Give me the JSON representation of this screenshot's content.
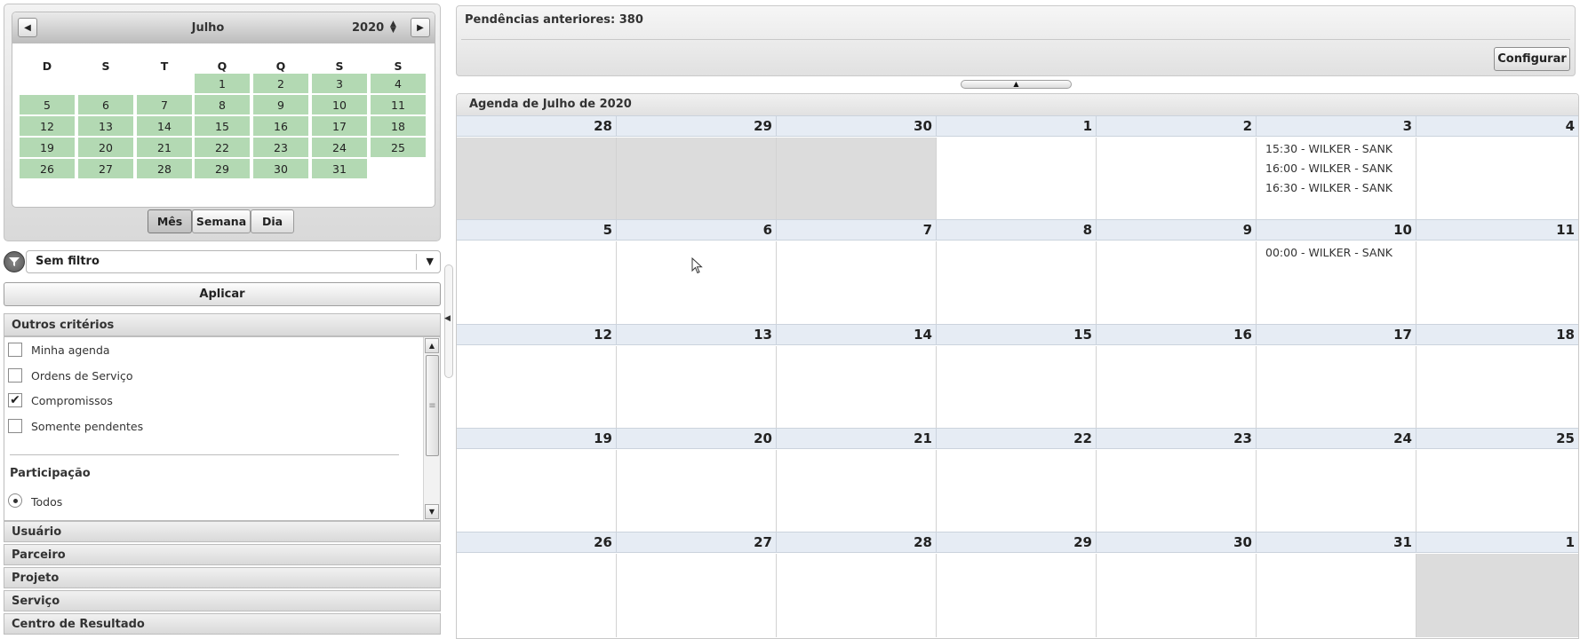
{
  "mini_calendar": {
    "month": "Julho",
    "year": "2020",
    "weekday_headers": [
      "D",
      "S",
      "T",
      "Q",
      "Q",
      "S",
      "S"
    ],
    "weeks": [
      [
        "",
        "",
        "",
        "1",
        "2",
        "3",
        "4"
      ],
      [
        "5",
        "6",
        "7",
        "8",
        "9",
        "10",
        "11"
      ],
      [
        "12",
        "13",
        "14",
        "15",
        "16",
        "17",
        "18"
      ],
      [
        "19",
        "20",
        "21",
        "22",
        "23",
        "24",
        "25"
      ],
      [
        "26",
        "27",
        "28",
        "29",
        "30",
        "31",
        ""
      ]
    ],
    "highlight_color": "#b3d9b3"
  },
  "view_buttons": {
    "month": "Mês",
    "week": "Semana",
    "day": "Dia",
    "active": "month"
  },
  "filter": {
    "selected": "Sem filtro",
    "apply_label": "Aplicar"
  },
  "criteria": {
    "title": "Outros critérios",
    "checkboxes": [
      {
        "label": "Minha agenda",
        "checked": false
      },
      {
        "label": "Ordens de Serviço",
        "checked": false
      },
      {
        "label": "Compromissos",
        "checked": true
      },
      {
        "label": "Somente pendentes",
        "checked": false
      }
    ],
    "participation_title": "Participação",
    "participation_option": "Todos"
  },
  "accordion": [
    "Usuário",
    "Parceiro",
    "Projeto",
    "Serviço",
    "Centro de Resultado"
  ],
  "pending": {
    "label": "Pendências anteriores: 380",
    "config_label": "Configurar"
  },
  "agenda": {
    "title": "Agenda de Julho de 2020",
    "weeks": [
      {
        "days": [
          "28",
          "29",
          "30",
          "1",
          "2",
          "3",
          "4"
        ],
        "other_month": [
          true,
          true,
          true,
          false,
          false,
          false,
          false
        ],
        "events": [
          [],
          [],
          [],
          [],
          [],
          [
            "15:30 - WILKER - SANK",
            "16:00 - WILKER - SANK",
            "16:30 - WILKER - SANK"
          ],
          []
        ]
      },
      {
        "days": [
          "5",
          "6",
          "7",
          "8",
          "9",
          "10",
          "11"
        ],
        "other_month": [
          false,
          false,
          false,
          false,
          false,
          false,
          false
        ],
        "events": [
          [],
          [],
          [],
          [],
          [],
          [
            "00:00 - WILKER - SANK"
          ],
          []
        ]
      },
      {
        "days": [
          "12",
          "13",
          "14",
          "15",
          "16",
          "17",
          "18"
        ],
        "other_month": [
          false,
          false,
          false,
          false,
          false,
          false,
          false
        ],
        "events": [
          [],
          [],
          [],
          [],
          [],
          [],
          []
        ]
      },
      {
        "days": [
          "19",
          "20",
          "21",
          "22",
          "23",
          "24",
          "25"
        ],
        "other_month": [
          false,
          false,
          false,
          false,
          false,
          false,
          false
        ],
        "events": [
          [],
          [],
          [],
          [],
          [],
          [],
          []
        ]
      },
      {
        "days": [
          "26",
          "27",
          "28",
          "29",
          "30",
          "31",
          "1"
        ],
        "other_month": [
          false,
          false,
          false,
          false,
          false,
          false,
          true
        ],
        "events": [
          [],
          [],
          [],
          [],
          [],
          [],
          []
        ]
      }
    ]
  }
}
